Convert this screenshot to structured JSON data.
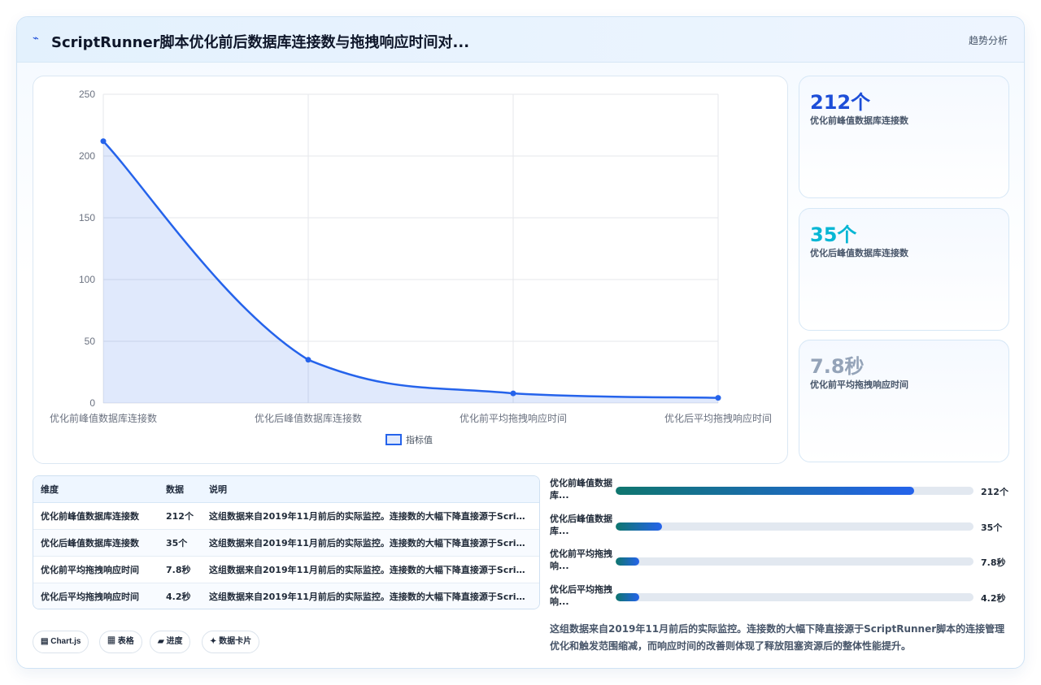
{
  "header": {
    "icon": "trend-icon",
    "title": "ScriptRunner脚本优化前后数据库连接数与拖拽响应时间对...",
    "tag": "趋势分析"
  },
  "chart_data": {
    "type": "line",
    "categories": [
      "优化前峰值数据库连接数",
      "优化后峰值数据库连接数",
      "优化前平均拖拽响应时间",
      "优化后平均拖拽响应时间"
    ],
    "series": [
      {
        "name": "指标值",
        "values": [
          212,
          35,
          7.8,
          4.2
        ]
      }
    ],
    "yticks": [
      0,
      50,
      100,
      150,
      200,
      250
    ],
    "ylim": [
      0,
      250
    ],
    "fill": true,
    "smooth": true,
    "grid": true,
    "legend": "bottom",
    "color": "#2563eb"
  },
  "kpis": [
    {
      "value": "212个",
      "label": "优化前峰值数据库连接数",
      "color": "#1d4ed8"
    },
    {
      "value": "35个",
      "label": "优化后峰值数据库连接数",
      "color": "#06b6d4"
    },
    {
      "value": "7.8秒",
      "label": "优化前平均拖拽响应时间",
      "color": "#94a3b8"
    }
  ],
  "table": {
    "headers": [
      "维度",
      "数据",
      "说明"
    ],
    "rows": [
      [
        "优化前峰值数据库连接数",
        "212个",
        "这组数据来自2019年11月前后的实际监控。连接数的大幅下降直接源于ScriptRunner脚本的连接管理优化和触发范围缩减，而响应时间的改善则体现了释放阻塞资源后的整体性能提升。"
      ],
      [
        "优化后峰值数据库连接数",
        "35个",
        "这组数据来自2019年11月前后的实际监控。连接数的大幅下降直接源于ScriptRunner脚本的连接管理优化和触发范围缩减，而响应时间的改善则体现了释放阻塞资源后的整体性能提升。"
      ],
      [
        "优化前平均拖拽响应时间",
        "7.8秒",
        "这组数据来自2019年11月前后的实际监控。连接数的大幅下降直接源于ScriptRunner脚本的连接管理优化和触发范围缩减，而响应时间的改善则体现了释放阻塞资源后的整体性能提升。"
      ],
      [
        "优化后平均拖拽响应时间",
        "4.2秒",
        "这组数据来自2019年11月前后的实际监控。连接数的大幅下降直接源于ScriptRunner脚本的连接管理优化和触发范围缩减，而响应时间的改善则体现了释放阻塞资源后的整体性能提升。"
      ]
    ]
  },
  "buttons": [
    {
      "icon": "chart-icon",
      "label": "▤ Chart.js"
    },
    {
      "icon": "table-icon",
      "label": "▦ 表格"
    },
    {
      "icon": "progress-icon",
      "label": "▰ 进度"
    },
    {
      "icon": "card-icon",
      "label": "✦ 数据卡片"
    }
  ],
  "bars": [
    {
      "label": "优化前峰值数据库...",
      "value": "212个",
      "fraction": 0.833
    },
    {
      "label": "优化后峰值数据库...",
      "value": "35个",
      "fraction": 0.13
    },
    {
      "label": "优化前平均拖拽响...",
      "value": "7.8秒",
      "fraction": 0.065
    },
    {
      "label": "优化后平均拖拽响...",
      "value": "4.2秒",
      "fraction": 0.065
    }
  ],
  "note": "这组数据来自2019年11月前后的实际监控。连接数的大幅下降直接源于ScriptRunner脚本的连接管理优化和触发范围缩减，而响应时间的改善则体现了释放阻塞资源后的整体性能提升。"
}
